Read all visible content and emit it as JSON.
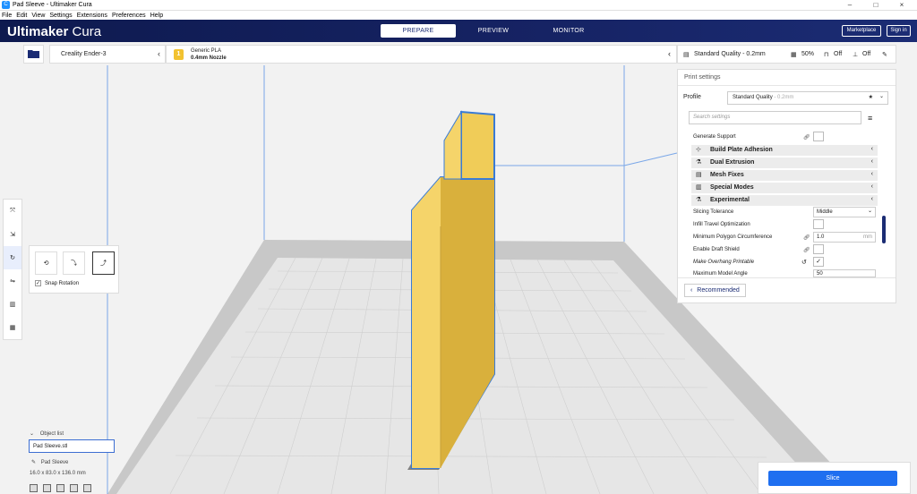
{
  "window": {
    "title": "Pad Sleeve - Ultimaker Cura"
  },
  "menu": [
    "File",
    "Edit",
    "View",
    "Settings",
    "Extensions",
    "Preferences",
    "Help"
  ],
  "header": {
    "brand_bold": "Ultimaker",
    "brand_light": " Cura",
    "tabs": [
      "PREPARE",
      "PREVIEW",
      "MONITOR"
    ],
    "marketplace": "Marketplace",
    "signin": "Sign in"
  },
  "printer": {
    "name": "Creality Ender-3"
  },
  "material": {
    "name": "Generic PLA",
    "nozzle": "0.4mm Nozzle",
    "badge": "1"
  },
  "quality": {
    "profile": "Standard Quality - 0.2mm",
    "infill": "50%",
    "support": "Off",
    "adhesion": "Off"
  },
  "settings": {
    "title": "Print settings",
    "profile_label": "Profile",
    "profile_value": "Standard Quality",
    "profile_suffix": " - 0.2mm",
    "search_placeholder": "Search settings",
    "generate_support": "Generate Support",
    "categories": [
      "Build Plate Adhesion",
      "Dual Extrusion",
      "Mesh Fixes",
      "Special Modes",
      "Experimental"
    ],
    "slicing_tolerance": "Slicing Tolerance",
    "slicing_tolerance_value": "Middle",
    "infill_travel": "Infill Travel Optimization",
    "min_polygon": "Minimum Polygon Circumference",
    "min_polygon_value": "1.0",
    "min_polygon_unit": "mm",
    "draft_shield": "Enable Draft Shield",
    "overhang": "Make Overhang Printable",
    "max_angle": "Maximum Model Angle",
    "max_angle_value": "50",
    "recommended": "Recommended"
  },
  "tools": {
    "snap_rotation": "Snap Rotation"
  },
  "objects": {
    "header": "Object list",
    "file": "Pad Sleeve.stl",
    "name": "Pad Sleeve",
    "dims": "16.0 x 83.0 x 136.0 mm"
  },
  "slice": {
    "label": "Slice"
  },
  "colors": {
    "accent": "#1f6ff0",
    "header": "#162364",
    "model": "#f5d46a",
    "outline": "#3a7bd5"
  }
}
